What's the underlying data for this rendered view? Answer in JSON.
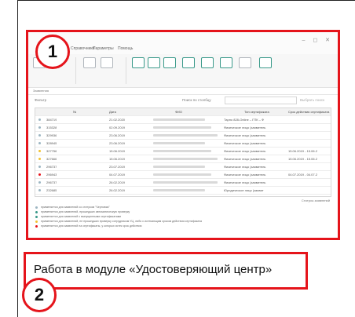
{
  "caption": "Работа в модуле «Удостоверяющий центр»",
  "badges": [
    "1",
    "2"
  ],
  "colors": {
    "frame": "#e5141b",
    "teal": "#3a9a8a"
  },
  "app": {
    "menu": [
      "Справочники",
      "Параметры",
      "Помощь"
    ],
    "window_controls": "– ◻ ✕",
    "section_title": "Заявления",
    "filter": {
      "label": "Фильтр",
      "search_label": "Поиск по столбцу",
      "button": "Выбрать поиск"
    },
    "grid": {
      "columns": [
        "",
        "№",
        "Дата",
        "ФИО",
        "Тип сертификата",
        "Срок действия сертификата"
      ],
      "rows": [
        {
          "status": "#9bb5c2",
          "num": "384719",
          "date": "21.02.2020",
          "type": "Тарпо 828-Online – ГПК – Ф",
          "period": ""
        },
        {
          "status": "#9bb5c2",
          "num": "315328",
          "date": "02.09.2019",
          "type": "Физическое лицо (заявитель",
          "period": ""
        },
        {
          "status": "#9bb5c2",
          "num": "329936",
          "date": "23.06.2019",
          "type": "Физическое лицо (заявитель",
          "period": ""
        },
        {
          "status": "#9bb5c2",
          "num": "328945",
          "date": "23.06.2019",
          "type": "Физическое лицо (заявитель",
          "period": ""
        },
        {
          "status": "#f2c230",
          "num": "327756",
          "date": "15.06.2019",
          "type": "Физическое лицо (заявитель",
          "period": "15.06.2019 - 15.06.2"
        },
        {
          "status": "#f2c230",
          "num": "327666",
          "date": "15.06.2019",
          "type": "Физическое лицо (заявитель",
          "period": "15.06.2019 - 15.06.2"
        },
        {
          "status": "#9bb5c2",
          "num": "296737",
          "date": "23.07.2019",
          "type": "Физическое лицо (заявитель",
          "period": ""
        },
        {
          "status": "#e5141b",
          "num": "296943",
          "date": "04.07.2019",
          "type": "Физическое лицо (заявитель",
          "period": "04.07.2019 - 04.07.2"
        },
        {
          "status": "#9bb5c2",
          "num": "296737",
          "date": "26.02.2019",
          "type": "Физическое лицо (заявитель",
          "period": ""
        },
        {
          "status": "#9bb5c2",
          "num": "232685",
          "date": "26.02.2019",
          "type": "Юридическое лицо (заявит",
          "period": ""
        }
      ]
    },
    "status_title": "Статусы заявлений",
    "legend": [
      {
        "color": "#9bb5c2",
        "text": "применяется для заявлений со статусом \"Черновик\""
      },
      {
        "color": "#3a9a8a",
        "text": "применяется для заявлений, прошедших автоматическую проверку"
      },
      {
        "color": "#3a9a8a",
        "text": "применяется для заявлений с выпущенными сертификатами"
      },
      {
        "color": "#f2c230",
        "text": "применяется для заявлений, не прошедших проверку сотрудником УЦ, либо с истекающим сроком действия сертификата"
      },
      {
        "color": "#e5141b",
        "text": "применяется для заявлений на сертификаты, у которых истек срок действия"
      }
    ]
  }
}
